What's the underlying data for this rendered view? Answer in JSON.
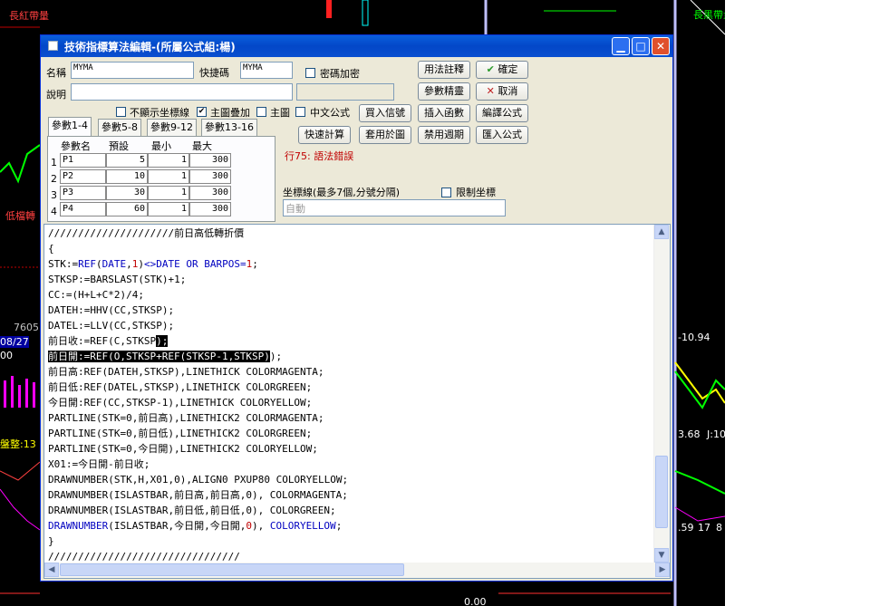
{
  "window": {
    "title": "技術指標算法編輯-(所屬公式組:楊)"
  },
  "form": {
    "name_label": "名稱",
    "name_value": "MYMA",
    "shortcut_label": "快捷碼",
    "shortcut_value": "MYMA",
    "password_label": "密碼加密",
    "desc_label": "說明",
    "desc_value": "",
    "hide_axis_label": "不顯示坐標線",
    "main_overlay_label": "主圖疊加",
    "main_overlay_checked": true,
    "main_chart_label": "主圖",
    "chinese_formula_label": "中文公式",
    "error_text": "行75: 語法錯誤",
    "axis_label": "坐標線(最多7個,分號分隔)",
    "limit_axis_label": "限制坐標",
    "axis_placeholder": "自動"
  },
  "buttons": {
    "usage_notes": "用法註釋",
    "ok": "確定",
    "param_wizard": "參數精靈",
    "cancel": "取消",
    "buy_signal": "買入信號",
    "insert_function": "插入函數",
    "compile_formula": "編譯公式",
    "quick_calc": "快速計算",
    "apply_chart": "套用於圖",
    "disable_period": "禁用週期",
    "import_formula": "匯入公式"
  },
  "tabs": [
    "參數1-4",
    "參數5-8",
    "參數9-12",
    "參數13-16"
  ],
  "params": {
    "headers": [
      "參數名",
      "預設",
      "最小",
      "最大"
    ],
    "rows": [
      {
        "idx": "1",
        "name": "P1",
        "default": "5",
        "min": "1",
        "max": "300"
      },
      {
        "idx": "2",
        "name": "P2",
        "default": "10",
        "min": "1",
        "max": "300"
      },
      {
        "idx": "3",
        "name": "P3",
        "default": "30",
        "min": "1",
        "max": "300"
      },
      {
        "idx": "4",
        "name": "P4",
        "default": "60",
        "min": "1",
        "max": "300"
      }
    ]
  },
  "code_lines": [
    "/////////////////////前日高低轉折價",
    "{",
    "STK:=REF(DATE,1)<>DATE OR BARPOS=1;",
    "STKSP:=BARSLAST(STK)+1;",
    "CC:=(H+L+C*2)/4;",
    "DATEH:=HHV(CC,STKSP);",
    "DATEL:=LLV(CC,STKSP);",
    "前日收:=REF(C,STKSP);",
    "前日開:=REF(O,STKSP+REF(STKSP-1,STKSP));",
    "前日高:REF(DATEH,STKSP),LINETHICK COLORMAGENTA;",
    "前日低:REF(DATEL,STKSP),LINETHICK COLORGREEN;",
    "今日開:REF(CC,STKSP-1),LINETHICK COLORYELLOW;",
    "PARTLINE(STK=0,前日高),LINETHICK2 COLORMAGENTA;",
    "PARTLINE(STK=0,前日低),LINETHICK2 COLORGREEN;",
    "PARTLINE(STK=0,今日開),LINETHICK2 COLORYELLOW;",
    "X01:=今日開-前日收;",
    "DRAWNUMBER(STK,H,X01,0),ALIGN0 PXUP80 COLORYELLOW;",
    "DRAWNUMBER(ISLASTBAR,前日高,前日高,0), COLORMAGENTA;",
    "DRAWNUMBER(ISLASTBAR,前日低,前日低,0), COLORGREEN;",
    "DRAWNUMBER(ISLASTBAR,今日開,今日開,0), COLORYELLOW;",
    "}",
    "////////////////////////////////"
  ],
  "background": {
    "labels": [
      "長紅帶量",
      "長黑帶量",
      "低檔轉",
      "盤整:13",
      "7605",
      "08/27",
      "00",
      "-10.94",
      "3.68",
      "J:10",
      ".59",
      "17",
      "8",
      "0.00"
    ]
  },
  "colors": {
    "titlebar": "#0a5fdc",
    "keyword": "#0000c0",
    "number": "#c00000",
    "error": "#c00000",
    "chart_bg": "#000000"
  }
}
